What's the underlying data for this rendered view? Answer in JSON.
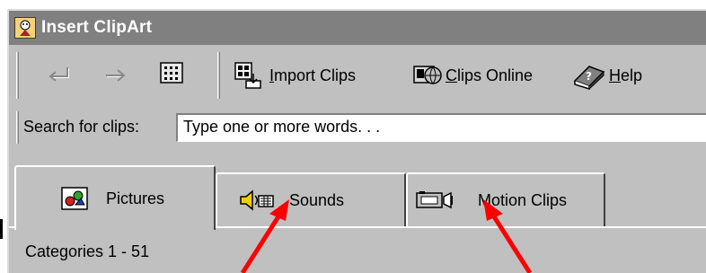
{
  "window": {
    "title": "Insert ClipArt"
  },
  "toolbar": {
    "back_icon": "back-arrow-icon",
    "forward_icon": "forward-arrow-icon",
    "keypad_icon": "keypad-icon",
    "import_label_underlined": "I",
    "import_label_rest": "mport Clips",
    "online_label_underlined": "C",
    "online_label_rest": "lips Online",
    "help_label_underlined": "H",
    "help_label_rest": "elp"
  },
  "search": {
    "label": "Search for clips:",
    "value": "Type one or more words. . ."
  },
  "tabs": [
    {
      "label": "Pictures",
      "icon": "pictures-icon",
      "active": true
    },
    {
      "label": "Sounds",
      "icon": "sounds-icon",
      "active": false
    },
    {
      "label": "Motion Clips",
      "icon": "motion-clips-icon",
      "active": false
    }
  ],
  "status": {
    "categories": "Categories 1 - 51"
  },
  "colors": {
    "window_bg": "#c0c0c0",
    "titlebar_bg": "#808080",
    "arrow": "#ff0000"
  }
}
